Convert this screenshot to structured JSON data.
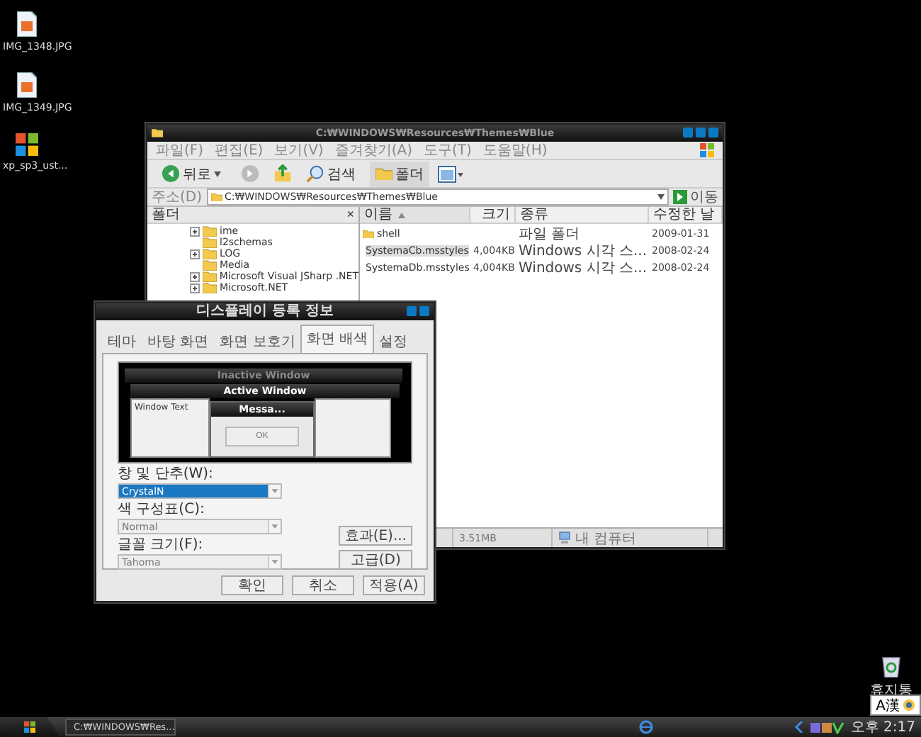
{
  "desktop_icons": [
    {
      "label": "IMG_1348.JPG",
      "kind": "image"
    },
    {
      "label": "IMG_1349.JPG",
      "kind": "image"
    },
    {
      "label": "xp_sp3_ust...",
      "kind": "setup"
    }
  ],
  "recycle_bin": {
    "label": "휴지통"
  },
  "explorer": {
    "title": "C:₩WINDOWS₩Resources₩Themes₩Blue",
    "menu": [
      "파일(F)",
      "편집(E)",
      "보기(V)",
      "즐겨찾기(A)",
      "도구(T)",
      "도움말(H)"
    ],
    "toolbar": {
      "back": "뒤로",
      "search": "검색",
      "folders": "폴더"
    },
    "address": {
      "label": "주소(D)",
      "value": "C:₩WINDOWS₩Resources₩Themes₩Blue",
      "go": "이동"
    },
    "folder_pane": {
      "title": "폴더",
      "close": "×",
      "items": [
        {
          "name": "ime",
          "expandable": true
        },
        {
          "name": "l2schemas",
          "expandable": false
        },
        {
          "name": "LOG",
          "expandable": true
        },
        {
          "name": "Media",
          "expandable": false
        },
        {
          "name": "Microsoft Visual JSharp .NET",
          "expandable": true
        },
        {
          "name": "Microsoft.NET",
          "expandable": true
        }
      ]
    },
    "columns": [
      {
        "label": "이름",
        "sorted": true
      },
      {
        "label": "크기",
        "sorted": false
      },
      {
        "label": "종류",
        "sorted": false
      },
      {
        "label": "수정한 날",
        "sorted": false
      }
    ],
    "files": [
      {
        "name": "shell",
        "type": "파일 폴더",
        "date": "2009-01-31",
        "kind": "folder",
        "selected": false
      },
      {
        "name": "SystemaCb.msstyles",
        "size": "4,004KB",
        "type": "Windows 시각 스...",
        "date": "2008-02-24",
        "kind": "style",
        "selected": true
      },
      {
        "name": "SystemaDb.msstyles",
        "size": "4,004KB",
        "type": "Windows 시각 스...",
        "date": "2008-02-24",
        "kind": "style",
        "selected": false
      }
    ],
    "status_bar": [
      "3.51MB",
      "내 컴퓨터"
    ]
  },
  "dialog": {
    "title": "디스플레이 등록 정보",
    "tabs": [
      {
        "label": "테마",
        "selected": false
      },
      {
        "label": "바탕 화면",
        "selected": false
      },
      {
        "label": "화면 보호기",
        "selected": false
      },
      {
        "label": "화면 배색",
        "selected": true
      },
      {
        "label": "설정",
        "selected": false
      }
    ],
    "preview": {
      "inactive_title": "Inactive Window",
      "active_title": "Active Window",
      "window_text": "Window Text",
      "message_title": "Messa...",
      "ok": "OK"
    },
    "fields": [
      {
        "label": "창 및 단추(W):",
        "value": "CrystalN",
        "selected": true
      },
      {
        "label": "색 구성표(C):",
        "value": "Normal",
        "selected": false
      },
      {
        "label": "글꼴 크기(F):",
        "value": "Tahoma",
        "selected": false
      }
    ],
    "side_buttons": [
      "효과(E)...",
      "고급(D)"
    ],
    "buttons": [
      "확인",
      "취소",
      "적용(A)"
    ]
  },
  "taskbar": {
    "tasks": [
      "C:₩WINDOWS₩Res..."
    ],
    "clock": "오후 2:17"
  },
  "ime_bar": {
    "label": "A漢"
  }
}
